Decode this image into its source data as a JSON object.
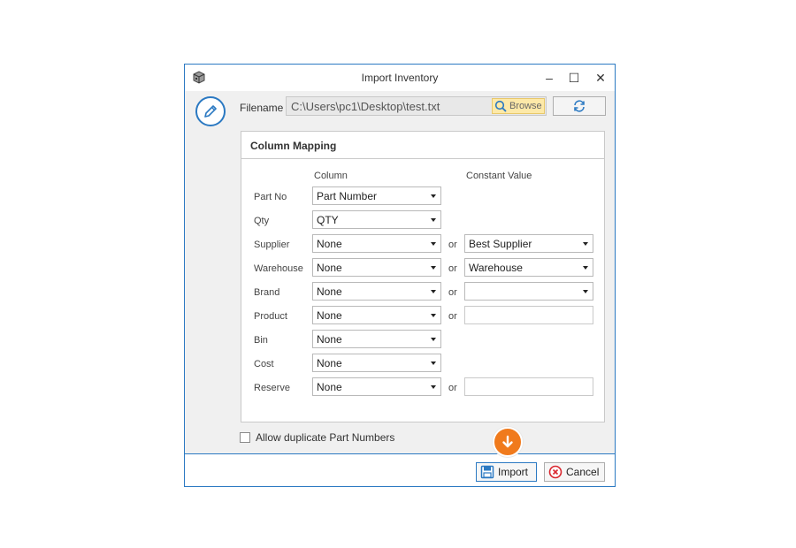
{
  "window": {
    "title": "Import Inventory",
    "accent_color": "#2b79c2",
    "controls": {
      "minimize": "–",
      "maximize": "☐",
      "close": "✕"
    }
  },
  "icons": {
    "app": "box-icon",
    "edit": "pencil-icon",
    "browse": "search-icon",
    "refresh": "refresh-icon",
    "import": "save-icon",
    "cancel": "cancel-circle-icon",
    "marker": "arrow-down-icon"
  },
  "file": {
    "label": "Filename",
    "value": "C:\\Users\\pc1\\Desktop\\test.txt",
    "browse_label": "Browse"
  },
  "mapping": {
    "title": "Column Mapping",
    "column_header": "Column",
    "constant_header": "Constant Value",
    "or_label": "or",
    "rows": [
      {
        "label": "Part No",
        "column": "Part Number"
      },
      {
        "label": "Qty",
        "column": "QTY"
      },
      {
        "label": "Supplier",
        "column": "None",
        "constant": "Best Supplier"
      },
      {
        "label": "Warehouse",
        "column": "None",
        "constant": "Warehouse"
      },
      {
        "label": "Brand",
        "column": "None",
        "constant": ""
      },
      {
        "label": "Product",
        "column": "None",
        "constant": ""
      },
      {
        "label": "Bin",
        "column": "None"
      },
      {
        "label": "Cost",
        "column": "None"
      },
      {
        "label": "Reserve",
        "column": "None",
        "constant": ""
      }
    ]
  },
  "options": {
    "allow_duplicates_label": "Allow duplicate Part Numbers",
    "allow_duplicates_checked": false
  },
  "buttons": {
    "import_label": "Import",
    "cancel_label": "Cancel"
  },
  "marker": {
    "color": "#f07a1c"
  }
}
